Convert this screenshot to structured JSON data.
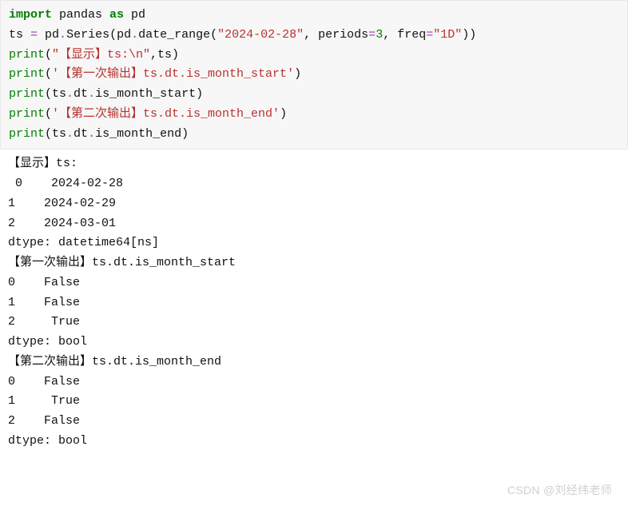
{
  "code": {
    "line1": {
      "kw1": "import",
      "mod": " pandas ",
      "kw2": "as",
      "alias": " pd"
    },
    "line2": {
      "pre": "ts ",
      "op1": "=",
      "mid1": " pd",
      "dot1": ".",
      "mid2": "Series(pd",
      "dot2": ".",
      "mid3": "date_range(",
      "str1": "\"2024-02-28\"",
      "mid4": ", periods",
      "op2": "=",
      "num1": "3",
      "mid5": ", freq",
      "op3": "=",
      "str2": "\"1D\"",
      "end": "))"
    },
    "line3": {
      "fn": "print",
      "open": "(",
      "str": "\"【显示】ts:\\n\"",
      "mid": ",ts)",
      "close": ""
    },
    "line4": {
      "fn": "print",
      "open": "(",
      "str": "'【第一次输出】ts.dt.is_month_start'",
      "close": ")"
    },
    "line5": {
      "fn": "print",
      "open": "(ts",
      "dot1": ".",
      "mid1": "dt",
      "dot2": ".",
      "mid2": "is_month_start)",
      "close": ""
    },
    "line6": {
      "fn": "print",
      "open": "(",
      "str": "'【第二次输出】ts.dt.is_month_end'",
      "close": ")"
    },
    "line7": {
      "fn": "print",
      "open": "(ts",
      "dot1": ".",
      "mid1": "dt",
      "dot2": ".",
      "mid2": "is_month_end)",
      "close": ""
    }
  },
  "output": {
    "l1": "【显示】ts:",
    "l2": " 0    2024-02-28",
    "l3": "1    2024-02-29",
    "l4": "2    2024-03-01",
    "l5": "dtype: datetime64[ns]",
    "l6": "【第一次输出】ts.dt.is_month_start",
    "l7": "0    False",
    "l8": "1    False",
    "l9": "2     True",
    "l10": "dtype: bool",
    "l11": "【第二次输出】ts.dt.is_month_end",
    "l12": "0    False",
    "l13": "1     True",
    "l14": "2    False",
    "l15": "dtype: bool"
  },
  "watermark": "CSDN @刘经纬老师"
}
